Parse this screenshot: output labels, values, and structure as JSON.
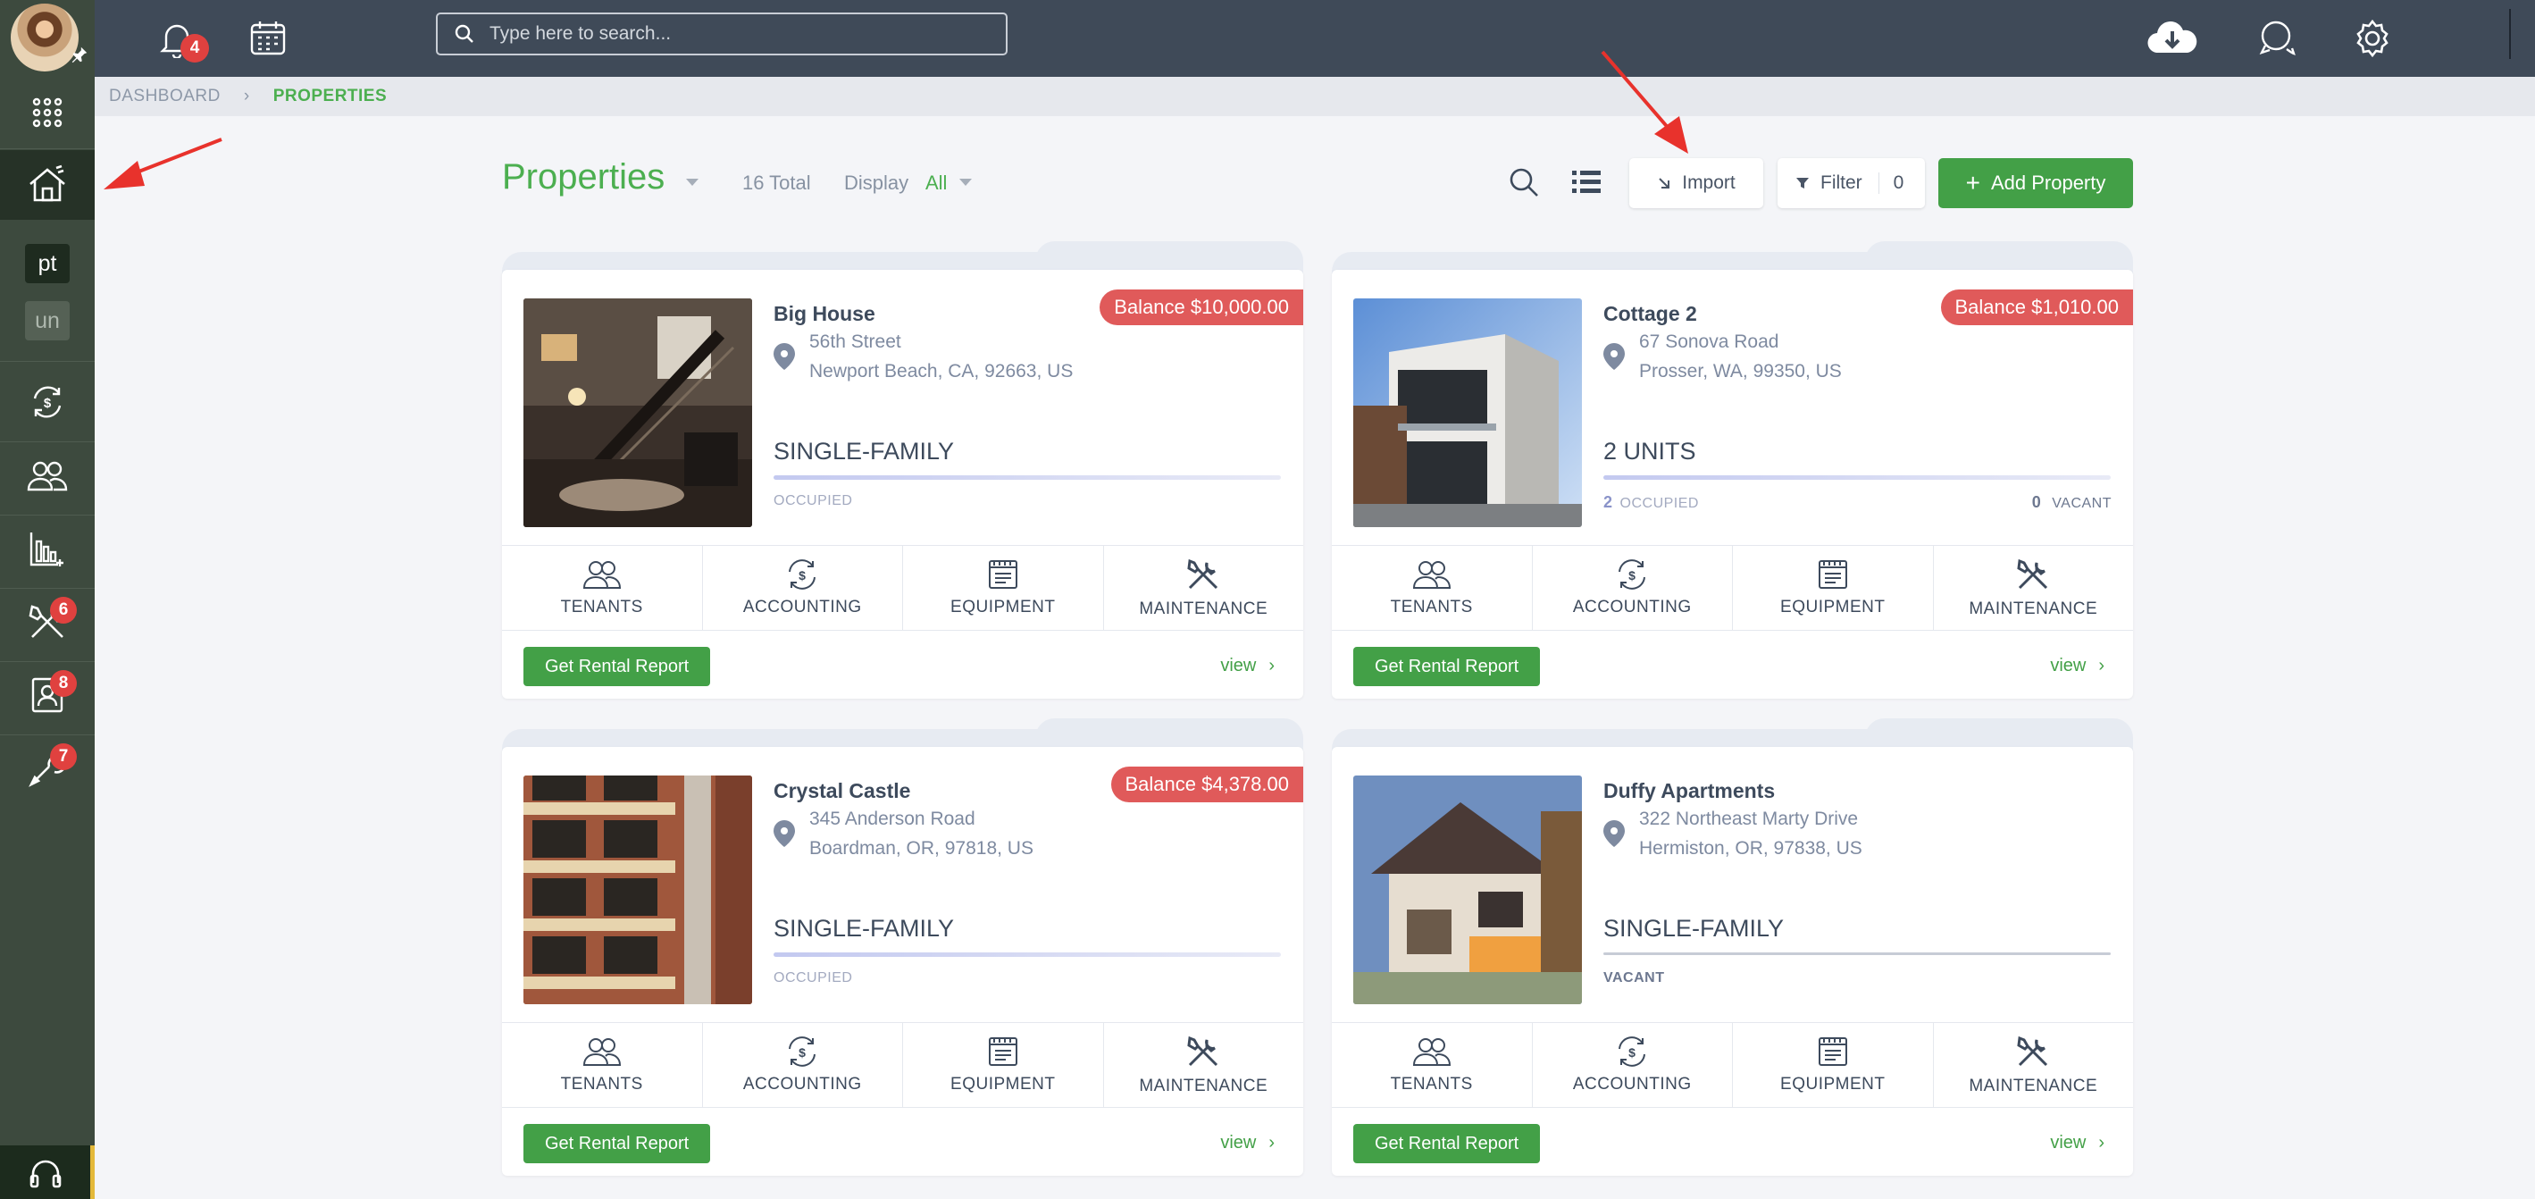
{
  "topbar": {
    "notifications_count": "4",
    "search_placeholder": "Type here to search..."
  },
  "sidebar": {
    "property_tag_active": "pt",
    "property_tag_inactive": "un",
    "maintenance_badge": "6",
    "tenant_badge": "8",
    "tools_badge": "7"
  },
  "breadcrumb": {
    "items": [
      "DASHBOARD",
      "PROPERTIES"
    ]
  },
  "header": {
    "title": "Properties",
    "total": "16 Total",
    "display_label": "Display",
    "display_value": "All",
    "import_label": "Import",
    "filter_label": "Filter",
    "filter_count": "0",
    "add_label": "Add Property"
  },
  "card_actions": [
    "TENANTS",
    "ACCOUNTING",
    "EQUIPMENT",
    "MAINTENANCE"
  ],
  "rental_report_label": "Get Rental Report",
  "view_label": "view",
  "properties": [
    {
      "balance": "Balance $10,000.00",
      "name": "Big House",
      "address1": "56th Street",
      "address2": "Newport Beach, CA, 92663, US",
      "type": "SINGLE-FAMILY",
      "status": "OCCUPIED"
    },
    {
      "balance": "Balance $1,010.00",
      "name": "Cottage 2",
      "address1": "67 Sonova Road",
      "address2": "Prosser, WA, 99350, US",
      "type": "2 UNITS",
      "occupied_count": "2",
      "occupied_label": "OCCUPIED",
      "vacant_count": "0",
      "vacant_label": "VACANT"
    },
    {
      "balance": "Balance $4,378.00",
      "name": "Crystal Castle",
      "address1": "345 Anderson Road",
      "address2": "Boardman, OR, 97818, US",
      "type": "SINGLE-FAMILY",
      "status": "OCCUPIED"
    },
    {
      "name": "Duffy Apartments",
      "address1": "322 Northeast Marty Drive",
      "address2": "Hermiston, OR, 97838, US",
      "type": "SINGLE-FAMILY",
      "status": "VACANT"
    }
  ],
  "colors": {
    "accent_green": "#4caf50",
    "button_green": "#43a047",
    "balance_red": "#e05a5a",
    "topbar": "#3f4a58",
    "sidebar": "#3d4a3e"
  }
}
